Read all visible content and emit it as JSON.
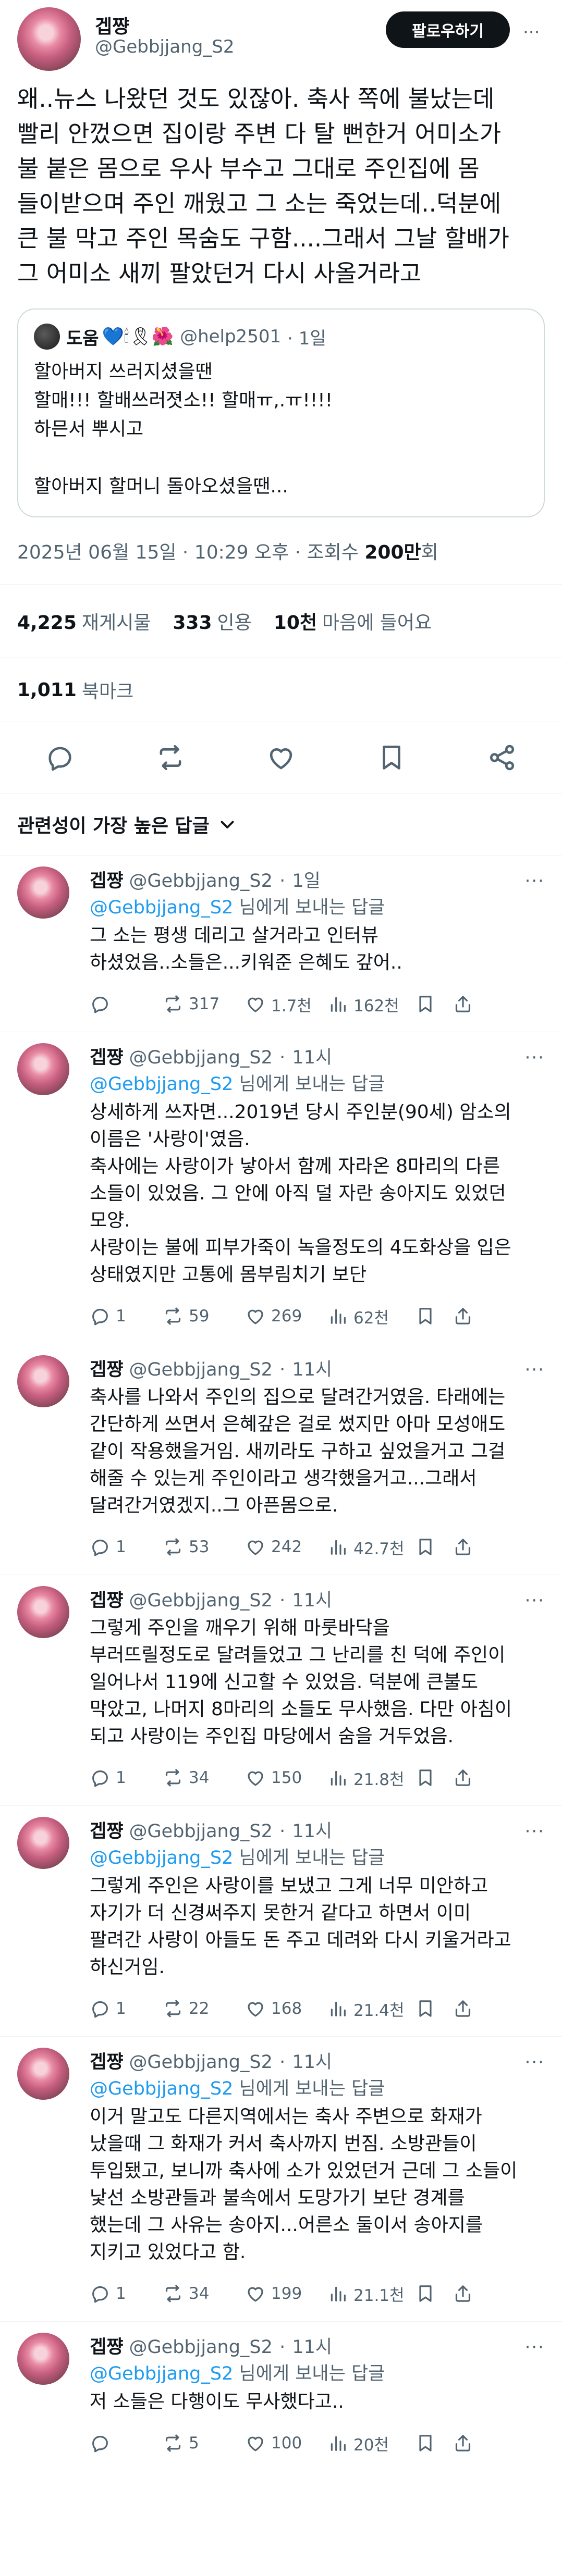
{
  "main": {
    "author_name": "겝쨩",
    "author_handle": "@Gebbjjang_S2",
    "follow_label": "팔로우하기",
    "more": "···",
    "text": "왜..뉴스 나왔던 것도 있잖아. 축사 쪽에 불났는데\n빨리 안껐으면 집이랑 주변 다 탈 뻔한거 어미소가\n불 붙은 몸으로 우사 부수고 그대로 주인집에 몸\n들이받으며 주인 깨웠고 그 소는 죽었는데..덕분에\n큰 불 막고 주인 목숨도 구함....그래서 그날 할배가\n그 어미소 새끼 팔았던거 다시 사올거라고",
    "quote": {
      "name": "도움",
      "emojis": "💙🕯🎗🌺",
      "handle": "@help2501",
      "time": "· 1일",
      "text": "할아버지 쓰러지셨을땐\n할매!!! 할배쓰러졋소!! 할매ㅠ,.ㅠ!!!!\n하믄서 뿌시고\n\n할아버지 할머니 돌아오셨을땐..."
    },
    "meta_prefix": "2025년 06월 15일 · 10:29 오후 · 조회수 ",
    "meta_views": "200만",
    "meta_suffix": "회",
    "stats": [
      {
        "value": "4,225",
        "label": "재게시물"
      },
      {
        "value": "333",
        "label": "인용"
      },
      {
        "value": "10천",
        "label": "마음에 들어요"
      }
    ],
    "bookmarks": {
      "value": "1,011",
      "label": "북마크"
    },
    "relevance_label": "관련성이 가장 높은 답글"
  },
  "replies": [
    {
      "name": "겝쨩",
      "handle": "@Gebbjjang_S2",
      "time": "1일",
      "mention": "@Gebbjjang_S2",
      "to_suffix": " 님에게 보내는 답글",
      "text": "그 소는 평생 데리고 살거라고 인터뷰\n하셨었음..소들은...키워준 은혜도 갚어..",
      "replies": "",
      "reposts": "317",
      "likes": "1.7천",
      "views": "162천"
    },
    {
      "name": "겝쨩",
      "handle": "@Gebbjjang_S2",
      "time": "11시",
      "mention": "@Gebbjjang_S2",
      "to_suffix": " 님에게 보내는 답글",
      "text": "상세하게 쓰자면...2019년 당시 주인분(90세) 암소의\n이름은 '사랑이'였음.\n축사에는 사랑이가 낳아서 함께 자라온 8마리의 다른\n소들이 있었음. 그 안에 아직 덜 자란 송아지도 있었던\n모양.\n사랑이는 불에 피부가죽이 녹을정도의 4도화상을 입은\n상태였지만 고통에 몸부림치기 보단",
      "replies": "1",
      "reposts": "59",
      "likes": "269",
      "views": "62천"
    },
    {
      "name": "겝쨩",
      "handle": "@Gebbjjang_S2",
      "time": "11시",
      "mention": "",
      "to_suffix": "",
      "text": "축사를 나와서 주인의 집으로 달려간거였음. 타래에는\n간단하게 쓰면서 은혜갚은 걸로 썼지만 아마 모성애도\n같이 작용했을거임. 새끼라도 구하고 싶었을거고 그걸\n해줄 수 있는게 주인이라고 생각했을거고...그래서\n달려간거였겠지..그 아픈몸으로.",
      "replies": "1",
      "reposts": "53",
      "likes": "242",
      "views": "42.7천"
    },
    {
      "name": "겝쨩",
      "handle": "@Gebbjjang_S2",
      "time": "11시",
      "mention": "",
      "to_suffix": "",
      "text": "그렇게 주인을 깨우기 위해 마룻바닥을\n부러뜨릴정도로 달려들었고 그 난리를 친 덕에 주인이\n일어나서 119에 신고할 수 있었음. 덕분에 큰불도\n막았고, 나머지 8마리의 소들도 무사했음. 다만 아침이\n되고 사랑이는 주인집 마당에서 숨을 거두었음.",
      "replies": "1",
      "reposts": "34",
      "likes": "150",
      "views": "21.8천"
    },
    {
      "name": "겝쨩",
      "handle": "@Gebbjjang_S2",
      "time": "11시",
      "mention": "@Gebbjjang_S2",
      "to_suffix": " 님에게 보내는 답글",
      "text": "그렇게 주인은 사랑이를 보냈고 그게 너무 미안하고\n자기가 더 신경써주지 못한거 같다고 하면서 이미\n팔려간 사랑이 아들도 돈 주고 데려와 다시 키울거라고\n하신거임.",
      "replies": "1",
      "reposts": "22",
      "likes": "168",
      "views": "21.4천"
    },
    {
      "name": "겝쨩",
      "handle": "@Gebbjjang_S2",
      "time": "11시",
      "mention": "@Gebbjjang_S2",
      "to_suffix": " 님에게 보내는 답글",
      "text": "이거 말고도 다른지역에서는 축사 주변으로 화재가\n났을때 그 화재가 커서 축사까지 번짐. 소방관들이\n투입됐고, 보니까 축사에 소가 있었던거 근데 그 소들이\n낯선 소방관들과 불속에서 도망가기 보단 경계를\n했는데 그 사유는 송아지...어른소 둘이서 송아지를\n지키고 있었다고 함.",
      "replies": "1",
      "reposts": "34",
      "likes": "199",
      "views": "21.1천"
    },
    {
      "name": "겝쨩",
      "handle": "@Gebbjjang_S2",
      "time": "11시",
      "mention": "@Gebbjjang_S2",
      "to_suffix": " 님에게 보내는 답글",
      "text": "저 소들은 다행이도 무사했다고..",
      "replies": "",
      "reposts": "5",
      "likes": "100",
      "views": "20천"
    }
  ]
}
